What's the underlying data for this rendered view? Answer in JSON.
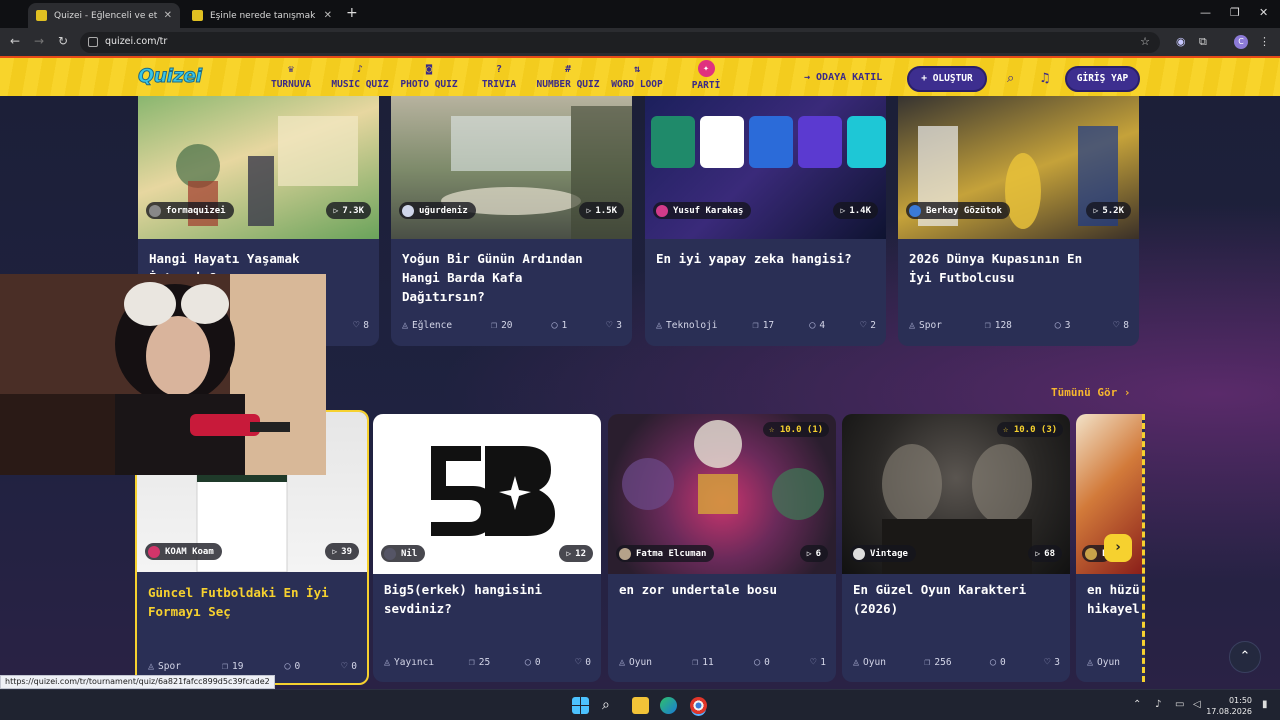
{
  "browser": {
    "tabs": [
      {
        "title": "Quizei - Eğlenceli ve etkileşimli",
        "active": true
      },
      {
        "title": "Eşinle nerede tanışmak isterdin",
        "active": false
      }
    ],
    "url": "quizei.com/tr",
    "profile_initial": "C",
    "icons": {
      "back": "arrow-left-icon",
      "forward": "arrow-right-icon",
      "reload": "reload-icon",
      "star": "star-icon",
      "extension": "puzzle-icon"
    }
  },
  "header": {
    "logo": "Quizei",
    "nav": [
      {
        "label": "TURNUVA",
        "icon": "trophy-icon",
        "glyph": "♛"
      },
      {
        "label": "MUSIC QUIZ",
        "icon": "music-icon",
        "glyph": "♪"
      },
      {
        "label": "PHOTO QUIZ",
        "icon": "camera-icon",
        "glyph": "◙"
      },
      {
        "label": "TRIVIA",
        "icon": "chat-icon",
        "glyph": "?"
      },
      {
        "label": "NUMBER QUIZ",
        "icon": "hash-icon",
        "glyph": "#"
      },
      {
        "label": "WORD LOOP",
        "icon": "sort-icon",
        "glyph": "⇅"
      },
      {
        "label": "PARTİ",
        "icon": "party-icon",
        "glyph": "✦"
      }
    ],
    "join_label": "→ ODAYA KATIL",
    "create_label": "+ OLUŞTUR",
    "login_label": "GİRİŞ YAP",
    "accent": "#f8d42b",
    "brand": "#3d2e8f"
  },
  "top_row": [
    {
      "author": "formaquizei",
      "plays": "7.3K",
      "title_lines": [
        "Hangi Hayatı Yaşamak",
        "İstersin?"
      ],
      "category": "",
      "questions": "",
      "comments": "",
      "likes": "8"
    },
    {
      "author": "uğurdeniz",
      "plays": "1.5K",
      "title_lines": [
        "Yoğun Bir Günün Ardından",
        "Hangi Barda Kafa",
        "Dağıtırsın?"
      ],
      "category": "Eğlence",
      "questions": "20",
      "comments": "1",
      "likes": "3"
    },
    {
      "author": "Yusuf Karakaş",
      "plays": "1.4K",
      "title_lines": [
        "En iyi yapay zeka hangisi?"
      ],
      "category": "Teknoloji",
      "questions": "17",
      "comments": "4",
      "likes": "2"
    },
    {
      "author": "Berkay Gözütok",
      "plays": "5.2K",
      "title_lines": [
        "2026 Dünya Kupasının En",
        "İyi Futbolcusu"
      ],
      "category": "Spor",
      "questions": "128",
      "comments": "3",
      "likes": "8"
    }
  ],
  "see_all": "Tümünü Gör ›",
  "bottom_row": [
    {
      "author": "KOAM Koam",
      "plays": "39",
      "rating": "",
      "title_lines": [
        "Güncel Futboldaki En İyi",
        "Formayı Seç"
      ],
      "category": "Spor",
      "questions": "19",
      "comments": "0",
      "likes": "0"
    },
    {
      "author": "Nil",
      "plays": "12",
      "rating": "",
      "title_lines": [
        "Big5(erkek) hangisini",
        "sevdiniz?"
      ],
      "category": "Yayıncı",
      "questions": "25",
      "comments": "0",
      "likes": "0"
    },
    {
      "author": "Fatma Elcuman",
      "plays": "6",
      "rating": "☆ 10.0 (1)",
      "title_lines": [
        "en zor undertale bosu"
      ],
      "category": "Oyun",
      "questions": "11",
      "comments": "0",
      "likes": "1"
    },
    {
      "author": "Vintage",
      "plays": "68",
      "rating": "☆ 10.0 (3)",
      "title_lines": [
        "En Güzel Oyun Karakteri",
        "(2026)"
      ],
      "category": "Oyun",
      "questions": "256",
      "comments": "0",
      "likes": "3"
    },
    {
      "author": "E",
      "plays": "",
      "rating": "",
      "title_lines": [
        "en hüzü",
        "hikayel"
      ],
      "category": "Oyun",
      "questions": "",
      "comments": "",
      "likes": ""
    }
  ],
  "status_url": "https://quizei.com/tr/tournament/quiz/6a821fafcc899d5c39fcade2",
  "taskbar": {
    "time": "01:50",
    "date": "17.08.2026"
  }
}
